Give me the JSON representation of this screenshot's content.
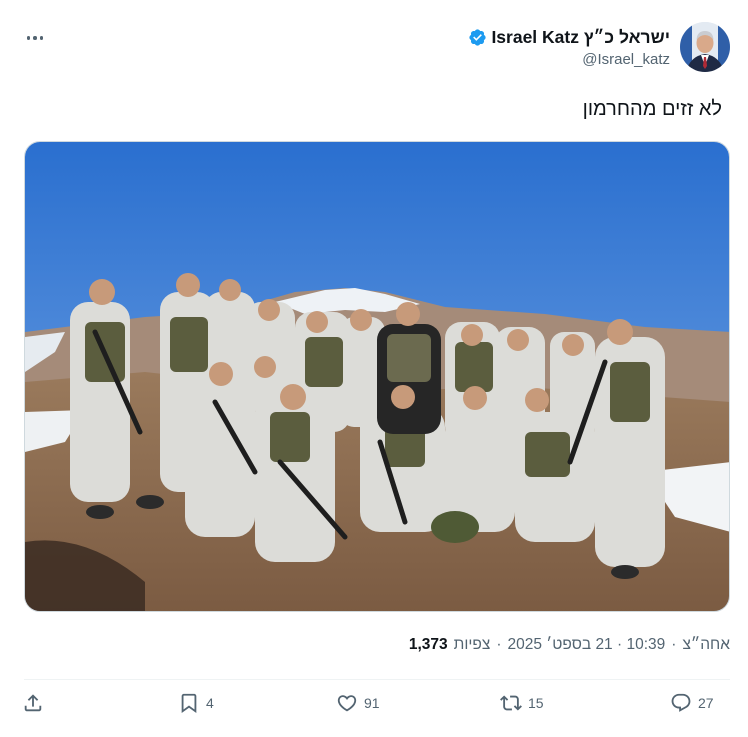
{
  "author": {
    "display_name": "Israel Katz ישראל כ״ץ",
    "handle": "@Israel_katz",
    "verified": true
  },
  "tweet": {
    "text": "לא זזים מהחרמון"
  },
  "meta": {
    "timestamp": "10:39 · 21 בספט׳ 2025",
    "separator_char": "·",
    "views_count": "1,373",
    "views_label": "צפיות",
    "source": "אחה״צ"
  },
  "actions": {
    "share_icon": "share-icon",
    "bookmark_count": "4",
    "like_count": "91",
    "retweet_count": "15",
    "reply_count": "27"
  },
  "colors": {
    "verified_blue": "#1d9bf0",
    "muted_text": "#536471",
    "primary_text": "#0f1419"
  }
}
